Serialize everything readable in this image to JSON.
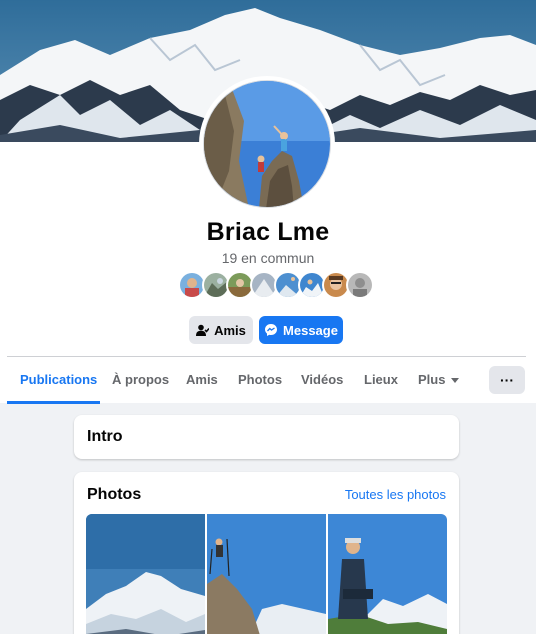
{
  "profile": {
    "name": "Briac Lme",
    "mutual_friends": "19 en commun"
  },
  "actions": {
    "friends_label": "Amis",
    "message_label": "Message"
  },
  "tabs": [
    {
      "label": "Publications",
      "active": true
    },
    {
      "label": "À propos"
    },
    {
      "label": "Amis"
    },
    {
      "label": "Photos"
    },
    {
      "label": "Vidéos"
    },
    {
      "label": "Lieux"
    },
    {
      "label": "Plus"
    }
  ],
  "more_button_label": "···",
  "intro": {
    "title": "Intro"
  },
  "photos": {
    "title": "Photos",
    "see_all": "Toutes les photos"
  },
  "colors": {
    "accent": "#1877f2",
    "background": "#f0f2f5",
    "secondary_text": "#65676b",
    "button_gray": "#e4e6eb"
  }
}
